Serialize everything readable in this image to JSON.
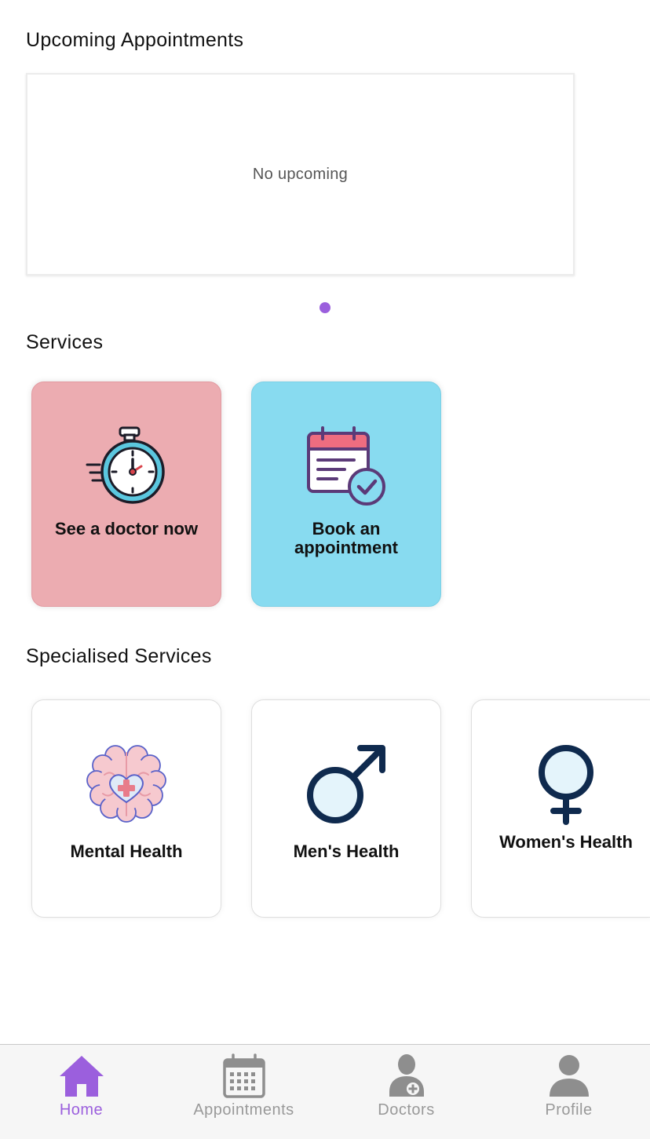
{
  "upcoming": {
    "title": "Upcoming Appointments",
    "empty_text": "No upcoming"
  },
  "services": {
    "title": "Services",
    "items": [
      {
        "label": "See a doctor now",
        "icon": "stopwatch-icon",
        "color": "#ecacb1"
      },
      {
        "label": "Book an appointment",
        "icon": "calendar-check-icon",
        "color": "#88dbf0"
      }
    ]
  },
  "specialised": {
    "title": "Specialised Services",
    "items": [
      {
        "label": "Mental Health",
        "icon": "brain-heart-icon"
      },
      {
        "label": "Men's Health",
        "icon": "male-symbol-icon"
      },
      {
        "label": "Women's Health",
        "icon": "female-symbol-icon"
      }
    ]
  },
  "tabbar": {
    "active_color": "#9b5fdd",
    "inactive_color": "#999999",
    "tabs": [
      {
        "label": "Home",
        "icon": "home-icon",
        "active": true
      },
      {
        "label": "Appointments",
        "icon": "calendar-icon",
        "active": false
      },
      {
        "label": "Doctors",
        "icon": "doctor-icon",
        "active": false
      },
      {
        "label": "Profile",
        "icon": "person-icon",
        "active": false
      }
    ]
  }
}
